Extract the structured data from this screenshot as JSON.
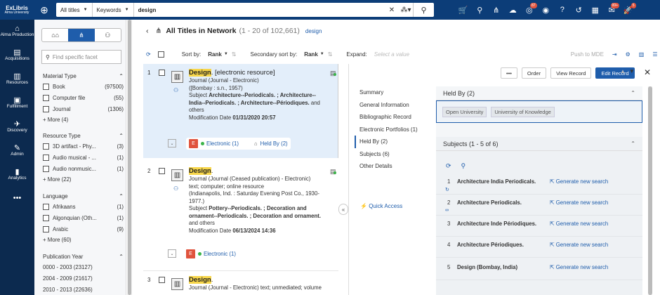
{
  "topbar": {
    "logo_line1": "ExLibris",
    "logo_line2": "Alma University",
    "search_scope": "All titles",
    "search_field": "Keywords",
    "search_query": "design",
    "badges": {
      "tasks": "87",
      "notifications": "99+",
      "alerts": "5"
    }
  },
  "leftnav": [
    {
      "label": "Alma Production",
      "icon": "alma-icon"
    },
    {
      "label": "Acquisitions",
      "icon": "acquisitions-icon"
    },
    {
      "label": "Resources",
      "icon": "resources-icon"
    },
    {
      "label": "Fulfillment",
      "icon": "fulfillment-icon"
    },
    {
      "label": "Discovery",
      "icon": "discovery-icon"
    },
    {
      "label": "Admin",
      "icon": "admin-icon"
    },
    {
      "label": "Analytics",
      "icon": "analytics-icon"
    },
    {
      "label": "•••",
      "icon": "more-icon"
    }
  ],
  "facets": {
    "find_placeholder": "Find specific facet",
    "groups": [
      {
        "title": "Material Type",
        "items": [
          {
            "label": "Book",
            "count": "(97500)"
          },
          {
            "label": "Computer file",
            "count": "(55)"
          },
          {
            "label": "Journal",
            "count": "(1306)"
          }
        ],
        "more": "More (4)"
      },
      {
        "title": "Resource Type",
        "items": [
          {
            "label": "3D artifact - Phy...",
            "count": "(3)"
          },
          {
            "label": "Audio musical - ...",
            "count": "(1)"
          },
          {
            "label": "Audio nonmusic...",
            "count": "(1)"
          }
        ],
        "more": "More (22)"
      },
      {
        "title": "Language",
        "items": [
          {
            "label": "Afrikaans",
            "count": "(1)"
          },
          {
            "label": "Algonquian (Oth...",
            "count": "(1)"
          },
          {
            "label": "Arabic",
            "count": "(9)"
          }
        ],
        "more": "More (60)"
      },
      {
        "title": "Publication Year",
        "years": [
          "0000 - 2003 (23127)",
          "2004 - 2009 (21617)",
          "2010 - 2013 (22636)"
        ]
      }
    ]
  },
  "header": {
    "title": "All Titles in Network",
    "count": "(1 - 20 of 102,661)",
    "keyword": "design"
  },
  "toolbar": {
    "sort_label": "Sort by:",
    "sort_value": "Rank",
    "secondary_label": "Secondary sort by:",
    "secondary_value": "Rank",
    "expand_label": "Expand:",
    "expand_placeholder": "Select a value",
    "push_label": "Push to MDE"
  },
  "results": [
    {
      "num": "1",
      "title_hl": "Design",
      "title_rest": ". [electronic resource]",
      "lines": [
        "Journal (Journal - Electronic)",
        "([Bombay : s.n., 1957)"
      ],
      "subject_label": "Subject",
      "subject": "Architecture--Periodicals. ; Architecture--India--Periodicals. ; Architecture--Périodiques.",
      "subject_tail": " and others",
      "mod_label": "Modification Date",
      "mod_date": "01/31/2020 20:57",
      "electronic": "Electronic (1)",
      "held": "Held By (2)"
    },
    {
      "num": "2",
      "title_hl": "Design",
      "title_rest": ".",
      "lines": [
        "Journal (Journal (Ceased publication) - Electronic) text; computer; online resource",
        "(Indianapolis, Ind. : Saturday Evening Post Co., 1930-1977.)"
      ],
      "subject_label": "Subject",
      "subject": "Pottery--Periodicals. ; Decoration and ornament--Periodicals. ; Decoration and ornament.",
      "subject_tail": " and others",
      "mod_label": "Modification Date",
      "mod_date": "06/13/2024 14:36",
      "electronic": "Electronic (1)"
    },
    {
      "num": "3",
      "title_hl": "Design",
      "title_rest": ".",
      "lines": [
        "Journal (Journal - Electronic) text; unmediated; volume"
      ]
    }
  ],
  "detail": {
    "buttons": {
      "more": "•••",
      "order": "Order",
      "view": "View Record",
      "edit": "Edit Record"
    },
    "nav": [
      "Summary",
      "General Information",
      "Bibliographic Record",
      "Electronic Portfolios (1)",
      "Held By (2)",
      "Subjects (6)",
      "Other Details"
    ],
    "quick_access": "Quick Access",
    "held_title": "Held By (2)",
    "held_chips": [
      "Open University",
      "University of Knowledge"
    ],
    "subjects_title": "Subjects (1 - 5 of 6)",
    "generate_label": "Generate new search",
    "subjects": [
      {
        "n": "1",
        "s": "Architecture India Periodicals."
      },
      {
        "n": "2",
        "s": "Architecture Periodicals."
      },
      {
        "n": "3",
        "s": "Architecture Inde Périodiques."
      },
      {
        "n": "4",
        "s": "Architecture Périodiques."
      },
      {
        "n": "5",
        "s": "Design (Bombay, India)"
      }
    ]
  }
}
